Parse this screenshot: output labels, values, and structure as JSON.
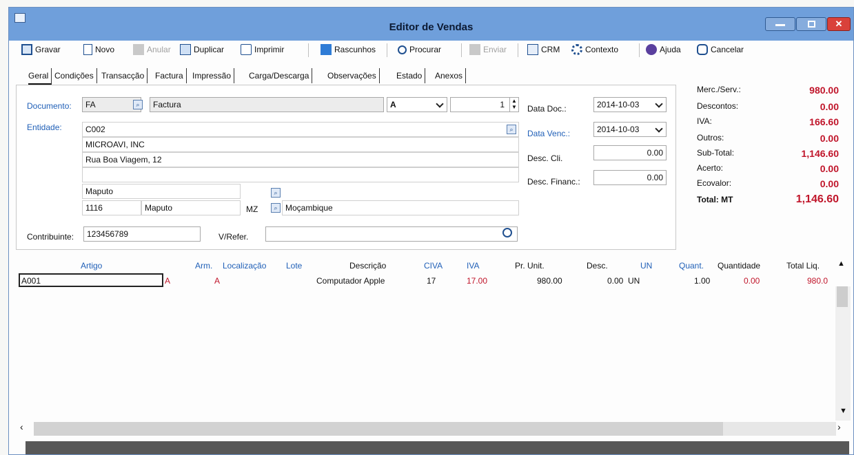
{
  "window": {
    "title": "Editor de Vendas"
  },
  "toolbar": [
    {
      "label": "Gravar",
      "icon": "save-icon",
      "enabled": true
    },
    {
      "label": "Novo",
      "icon": "new-document-icon",
      "enabled": true
    },
    {
      "label": "Anular",
      "icon": "cancel-document-icon",
      "enabled": false
    },
    {
      "label": "Duplicar",
      "icon": "duplicate-icon",
      "enabled": true
    },
    {
      "label": "Imprimir",
      "icon": "printer-icon",
      "enabled": true
    },
    {
      "label": "Rascunhos",
      "icon": "drafts-icon",
      "enabled": true
    },
    {
      "label": "Procurar",
      "icon": "search-icon",
      "enabled": true
    },
    {
      "label": "Enviar",
      "icon": "send-icon",
      "enabled": false
    },
    {
      "label": "CRM",
      "icon": "crm-icon",
      "enabled": true
    },
    {
      "label": "Contexto",
      "icon": "gear-icon",
      "enabled": true
    },
    {
      "label": "Ajuda",
      "icon": "help-icon",
      "enabled": true
    },
    {
      "label": "Cancelar",
      "icon": "close-icon",
      "enabled": true
    }
  ],
  "tabs": [
    "Geral",
    "Condições",
    "Transacção",
    "Factura",
    "Impressão",
    "Carga/Descarga",
    "Observações",
    "Estado",
    "Anexos"
  ],
  "header": {
    "documento_label": "Documento:",
    "doc_type": "FA",
    "doc_name": "Factura",
    "serie": "A",
    "number": "1",
    "entidade_label": "Entidade:",
    "entity_code": "C002",
    "entity_name": "MICROAVI, INC",
    "address1": "Rua Boa Viagem, 12",
    "address2": "",
    "city": "Maputo",
    "postal_code": "1116",
    "locality": "Maputo",
    "country_code": "MZ",
    "country": "Moçambique",
    "contribuinte_label": "Contribuinte:",
    "contribuinte": "123456789",
    "vrefer_label": "V/Refer.",
    "vrefer": "",
    "data_doc_label": "Data Doc.:",
    "data_doc": "2014-10-03",
    "data_venc_label": "Data Venc.:",
    "data_venc": "2014-10-03",
    "desc_cli_label": "Desc. Cli.",
    "desc_cli": "0.00",
    "desc_financ_label": "Desc. Financ.:",
    "desc_financ": "0.00"
  },
  "totals": [
    {
      "label": "Merc./Serv.:",
      "value": "980.00"
    },
    {
      "label": "Descontos:",
      "value": "0.00"
    },
    {
      "label": "IVA:",
      "value": "166.60"
    },
    {
      "label": "Outros:",
      "value": "0.00"
    },
    {
      "label": "Sub-Total:",
      "value": "1,146.60"
    },
    {
      "label": "Acerto:",
      "value": "0.00"
    },
    {
      "label": "Ecovalor:",
      "value": "0.00"
    },
    {
      "label": "Total: MT",
      "value": "1,146.60"
    }
  ],
  "grid": {
    "columns": [
      "Artigo",
      "Arm.",
      "Localização",
      "Lote",
      "Descrição",
      "CIVA",
      "IVA",
      "Pr. Unit.",
      "Desc.",
      "UN",
      "Quant.",
      "Quantidade",
      "Total Liq."
    ],
    "rows": [
      {
        "artigo": "A001",
        "arm": "A",
        "localizacao": "A",
        "lote": "",
        "descricao": "Computador Apple",
        "civa": "17",
        "iva": "17.00",
        "pr_unit": "980.00",
        "desc": "0.00",
        "un": "UN",
        "quant": "1.00",
        "quantidade": "0.00",
        "total_liq": "980.0"
      }
    ]
  },
  "colors": {
    "titlebar": "#6f9fdb",
    "accent_blue": "#1f5fb7",
    "value_red": "#c0152a",
    "close_button": "#d9413a"
  }
}
